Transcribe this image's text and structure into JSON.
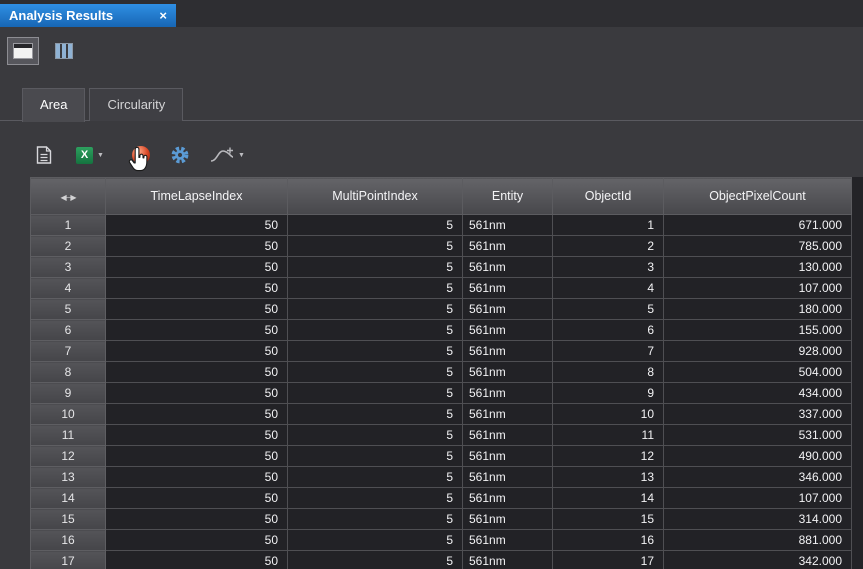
{
  "panel": {
    "title": "Analysis Results",
    "close_label": "×"
  },
  "tabs": [
    {
      "label": "Area",
      "active": true
    },
    {
      "label": "Circularity",
      "active": false
    }
  ],
  "icons": {
    "excel_glyph": "X",
    "caret_glyph": "▼",
    "resize_glyph": "◀─▶"
  },
  "colors": {
    "title_tab_blue": "#1d78c8",
    "excel_green": "#1e8a4f",
    "gear_blue": "#5b9bd5",
    "sphere_red": "#d84524",
    "grid_cell_bg": "#222226",
    "panel_bg": "#3a3a3e"
  },
  "table": {
    "columns": [
      "TimeLapseIndex",
      "MultiPointIndex",
      "Entity",
      "ObjectId",
      "ObjectPixelCount"
    ],
    "row_keys": [
      "n",
      "timelapse",
      "multipoint",
      "entity",
      "objectid",
      "pixelcount"
    ],
    "rows": [
      {
        "n": "1",
        "timelapse": "50",
        "multipoint": "5",
        "entity": "561nm",
        "objectid": "1",
        "pixelcount": "671.000"
      },
      {
        "n": "2",
        "timelapse": "50",
        "multipoint": "5",
        "entity": "561nm",
        "objectid": "2",
        "pixelcount": "785.000"
      },
      {
        "n": "3",
        "timelapse": "50",
        "multipoint": "5",
        "entity": "561nm",
        "objectid": "3",
        "pixelcount": "130.000"
      },
      {
        "n": "4",
        "timelapse": "50",
        "multipoint": "5",
        "entity": "561nm",
        "objectid": "4",
        "pixelcount": "107.000"
      },
      {
        "n": "5",
        "timelapse": "50",
        "multipoint": "5",
        "entity": "561nm",
        "objectid": "5",
        "pixelcount": "180.000"
      },
      {
        "n": "6",
        "timelapse": "50",
        "multipoint": "5",
        "entity": "561nm",
        "objectid": "6",
        "pixelcount": "155.000"
      },
      {
        "n": "7",
        "timelapse": "50",
        "multipoint": "5",
        "entity": "561nm",
        "objectid": "7",
        "pixelcount": "928.000"
      },
      {
        "n": "8",
        "timelapse": "50",
        "multipoint": "5",
        "entity": "561nm",
        "objectid": "8",
        "pixelcount": "504.000"
      },
      {
        "n": "9",
        "timelapse": "50",
        "multipoint": "5",
        "entity": "561nm",
        "objectid": "9",
        "pixelcount": "434.000"
      },
      {
        "n": "10",
        "timelapse": "50",
        "multipoint": "5",
        "entity": "561nm",
        "objectid": "10",
        "pixelcount": "337.000"
      },
      {
        "n": "11",
        "timelapse": "50",
        "multipoint": "5",
        "entity": "561nm",
        "objectid": "11",
        "pixelcount": "531.000"
      },
      {
        "n": "12",
        "timelapse": "50",
        "multipoint": "5",
        "entity": "561nm",
        "objectid": "12",
        "pixelcount": "490.000"
      },
      {
        "n": "13",
        "timelapse": "50",
        "multipoint": "5",
        "entity": "561nm",
        "objectid": "13",
        "pixelcount": "346.000"
      },
      {
        "n": "14",
        "timelapse": "50",
        "multipoint": "5",
        "entity": "561nm",
        "objectid": "14",
        "pixelcount": "107.000"
      },
      {
        "n": "15",
        "timelapse": "50",
        "multipoint": "5",
        "entity": "561nm",
        "objectid": "15",
        "pixelcount": "314.000"
      },
      {
        "n": "16",
        "timelapse": "50",
        "multipoint": "5",
        "entity": "561nm",
        "objectid": "16",
        "pixelcount": "881.000"
      },
      {
        "n": "17",
        "timelapse": "50",
        "multipoint": "5",
        "entity": "561nm",
        "objectid": "17",
        "pixelcount": "342.000"
      }
    ]
  }
}
